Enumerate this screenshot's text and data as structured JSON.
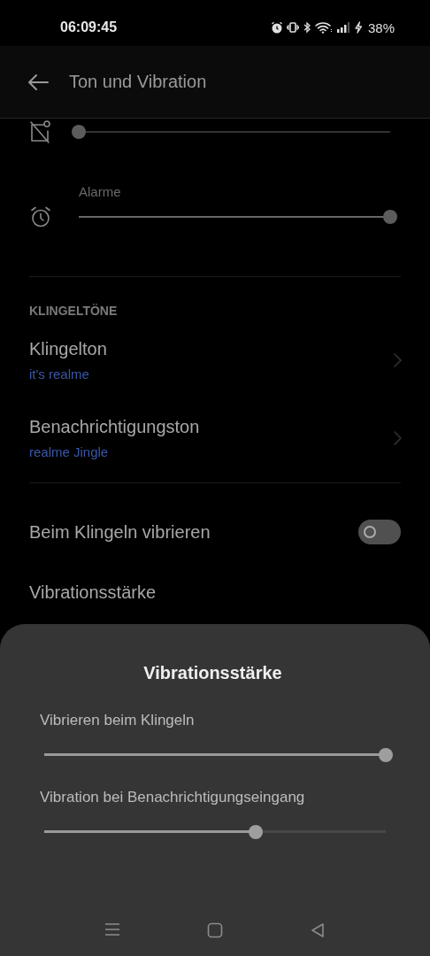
{
  "status_bar": {
    "time": "06:09:45",
    "battery": "38%"
  },
  "app_bar": {
    "title": "Ton und Vibration"
  },
  "volume_sliders": [
    {
      "kind": "muted",
      "level": 0
    },
    {
      "kind": "alarm",
      "label": "Alarme",
      "level": 1
    }
  ],
  "section": {
    "title": "KLINGELTÖNE"
  },
  "ringtones": [
    {
      "title": "Klingelton",
      "value": "it's realme"
    },
    {
      "title": "Benachrichtigungston",
      "value": "realme Jingle"
    }
  ],
  "toggles": [
    {
      "label": "Beim Klingeln vibrieren",
      "on": false
    }
  ],
  "vibration_item": {
    "title": "Vibrationsstärke"
  },
  "sheet": {
    "title": "Vibrationsstärke",
    "sliders": [
      {
        "label": "Vibrieren beim Klingeln",
        "level": 1
      },
      {
        "label": "Vibration bei Benachrichtigungseingang",
        "level": 0.62
      }
    ]
  },
  "nav_bar": {
    "buttons": [
      {
        "kind": "menu"
      },
      {
        "kind": "home"
      },
      {
        "kind": "back"
      }
    ]
  }
}
